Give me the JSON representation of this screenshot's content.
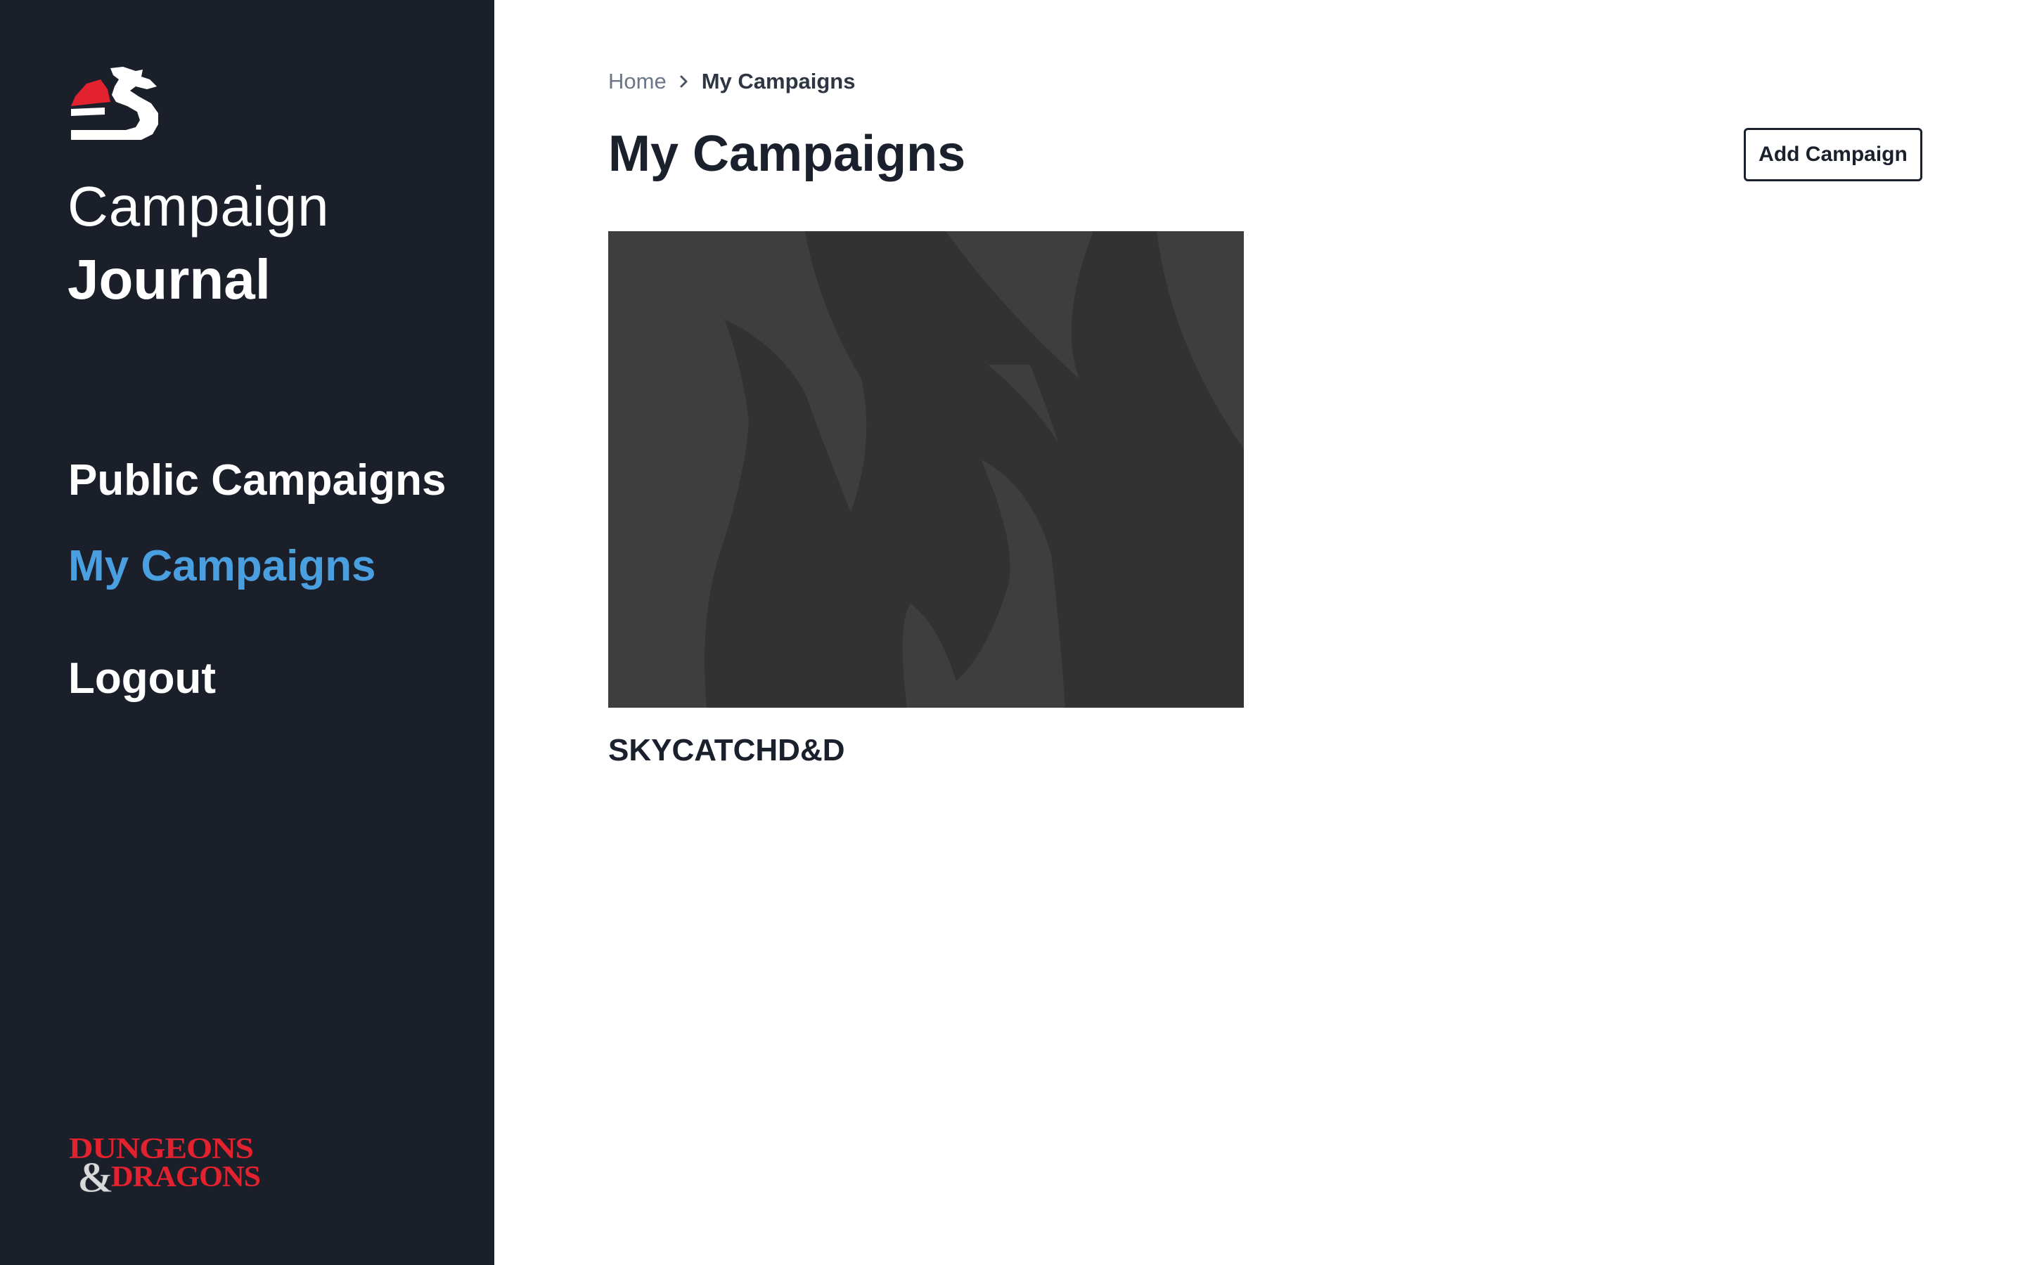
{
  "sidebar": {
    "title_light": "Campaign",
    "title_bold": "Journal",
    "nav": {
      "public_campaigns": "Public Campaigns",
      "my_campaigns": "My Campaigns",
      "logout": "Logout"
    },
    "brand_logo": {
      "line1": "DUNGEONS",
      "ampersand": "&",
      "line2": "DRAGONS"
    }
  },
  "breadcrumb": {
    "home": "Home",
    "current": "My Campaigns"
  },
  "page": {
    "title": "My Campaigns",
    "add_button": "Add Campaign"
  },
  "campaigns": [
    {
      "name": "SKYCATCHD&D"
    }
  ],
  "colors": {
    "sidebar_bg": "#1b1f2a",
    "active_nav": "#4a9fe0",
    "brand_red": "#e2222e",
    "card_bg": "#333333"
  },
  "icons": {
    "app_logo": "dragon-logo-icon",
    "breadcrumb_separator": "chevron-right-icon"
  }
}
